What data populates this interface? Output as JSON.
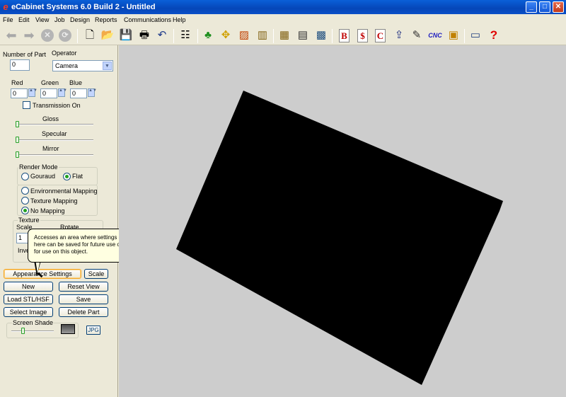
{
  "window": {
    "title": "eCabinet Systems 6.0 Build 2 - Untitled",
    "app_icon": "ecabinet-logo",
    "controls": [
      "minimize-icon",
      "maximize-icon",
      "close-icon"
    ],
    "minimize_glyph": "_",
    "maximize_glyph": "□",
    "close_glyph": "✕"
  },
  "menu": [
    "File",
    "Edit",
    "View",
    "Job",
    "Design",
    "Reports",
    "Communications",
    "Help"
  ],
  "toolbar": {
    "cnc_label": "CNC",
    "letters": [
      "B",
      "$",
      "C"
    ]
  },
  "panel": {
    "number_of_part_label": "Number of Part",
    "number_of_part_value": "0",
    "operator_label": "Operator",
    "operator_value": "Camera",
    "red_label": "Red",
    "red_value": "0",
    "green_label": "Green",
    "green_value": "0",
    "blue_label": "Blue",
    "blue_value": "0",
    "transmission_label": "Transmission On",
    "transmission_checked": false,
    "gloss_label": "Gloss",
    "specular_label": "Specular",
    "mirror_label": "Mirror",
    "render_mode_label": "Render Mode",
    "gouraud_label": "Gouraud",
    "flat_label": "Flat",
    "render_mode_selected": "Flat",
    "env_mapping_label": "Environmental Mapping",
    "texture_mapping_label": "Texture Mapping",
    "no_mapping_label": "No Mapping",
    "mapping_selected": "No Mapping",
    "texture_label": "Texture",
    "scale_label_partial": "Scale",
    "rotate_label_partial": "Rotate",
    "texture_scale_value": "1",
    "invert_label_partial": "Inve",
    "screen_shade_label": "Screen Shade",
    "jpg_label": "JPG"
  },
  "buttons": {
    "appearance_settings": "Appearance Settings",
    "scale": "Scale",
    "new": "New",
    "reset_view": "Reset View",
    "load_stl": "Load STL/HSF",
    "save": "Save",
    "select_image": "Select Image",
    "delete_part": "Delete Part"
  },
  "tooltip": {
    "text": "Accesses an area where settings defined here can be saved for future use or retrieved for use on this object."
  },
  "viewport": {
    "background": "#cdcdcd",
    "model_color": "#000000"
  },
  "colors": {
    "titlebar": "#0546b8",
    "panel_bg": "#ece9d8"
  }
}
